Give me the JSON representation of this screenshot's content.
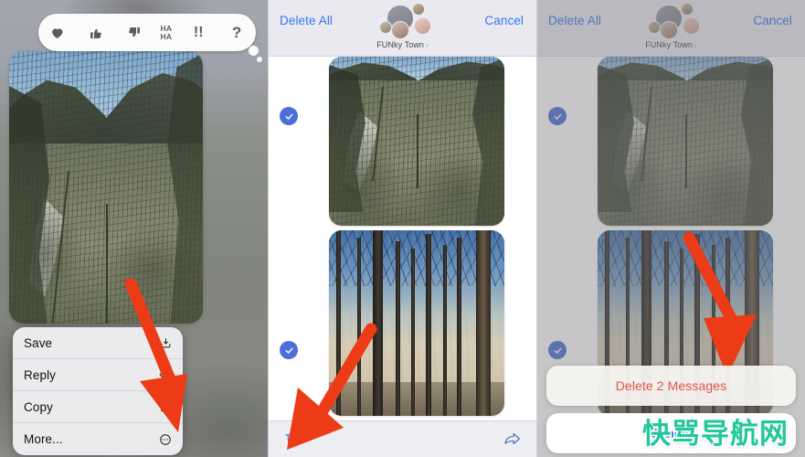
{
  "meta": {
    "app": "Messages",
    "watermark": "快骂导航网"
  },
  "colors": {
    "ios_blue": "#3577f0",
    "check_blue": "#4c6ed7",
    "destructive_red": "#e2544a",
    "arrow_red": "#ec3b16",
    "toolbar_icon": "#5b7bbd",
    "watermark_green": "#22c79a"
  },
  "panel1": {
    "name": "context-menu-panel",
    "reactions": [
      {
        "id": "heart-reaction",
        "label": "Heart"
      },
      {
        "id": "thumbs-up-reaction",
        "label": "Thumbs Up"
      },
      {
        "id": "thumbs-down-reaction",
        "label": "Thumbs Down"
      },
      {
        "id": "haha-reaction",
        "label_line1": "HA",
        "label_line2": "HA"
      },
      {
        "id": "exclamation-reaction",
        "label": "!!"
      },
      {
        "id": "question-reaction",
        "label": "?"
      }
    ],
    "menu": [
      {
        "label": "Save",
        "icon": "save-icon"
      },
      {
        "label": "Reply",
        "icon": "reply-icon"
      },
      {
        "label": "Copy",
        "icon": "copy-icon"
      },
      {
        "label": "More...",
        "icon": "more-icon"
      }
    ],
    "photo_alt": "Gorge landscape photo"
  },
  "panel2": {
    "name": "multi-select-panel",
    "header": {
      "left_action": "Delete All",
      "right_action": "Cancel",
      "group_name": "FUNky Town",
      "chevron": "›"
    },
    "messages": [
      {
        "id": "message-photo-1",
        "selected": true,
        "alt": "Gorge landscape photo"
      },
      {
        "id": "message-photo-2",
        "selected": true,
        "alt": "Forest trees photo"
      }
    ],
    "toolbar": {
      "trash": "trash-icon",
      "share": "share-icon"
    }
  },
  "panel3": {
    "name": "delete-confirmation-panel",
    "header": {
      "left_action": "Delete All",
      "right_action": "Cancel",
      "group_name": "FUNky Town",
      "chevron": "›"
    },
    "messages": [
      {
        "id": "message-photo-1",
        "selected": true,
        "alt": "Gorge landscape photo"
      },
      {
        "id": "message-photo-2",
        "selected": true,
        "alt": "Forest trees photo"
      }
    ],
    "action_sheet": {
      "destructive_label": "Delete 2 Messages",
      "cancel_label": "Cancel"
    }
  }
}
